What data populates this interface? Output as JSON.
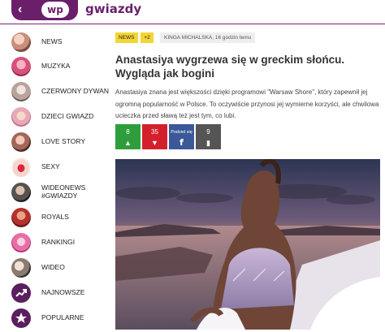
{
  "header": {
    "brand": "gwiazdy",
    "logo_text": "wp"
  },
  "sidebar": {
    "items": [
      {
        "label": "NEWS",
        "icon": "news-thumb-icon"
      },
      {
        "label": "MUZYKA",
        "icon": "music-thumb-icon"
      },
      {
        "label": "CZERWONY DYWAN",
        "icon": "red-carpet-thumb-icon"
      },
      {
        "label": "DZIECI GWIAZD",
        "icon": "star-kids-thumb-icon"
      },
      {
        "label": "LOVE STORY",
        "icon": "love-story-thumb-icon"
      },
      {
        "label": "SEXY",
        "icon": "sexy-thumb-icon"
      },
      {
        "label": "WIDEONEWS #GWIAZDY",
        "icon": "videonews-thumb-icon"
      },
      {
        "label": "ROYALS",
        "icon": "royals-thumb-icon"
      },
      {
        "label": "RANKINGI",
        "icon": "rankings-thumb-icon"
      },
      {
        "label": "WIDEO",
        "icon": "video-thumb-icon"
      },
      {
        "label": "NAJNOWSZE",
        "icon": "trending-arrow-icon"
      },
      {
        "label": "POPULARNE",
        "icon": "star-icon"
      }
    ]
  },
  "article": {
    "badge": "NEWS",
    "badge_count": "+2",
    "author": "KINGA MICHALSKA, 16 godzin temu",
    "title": "Anastasiya wygrzewa się w greckim słońcu. Wygląda jak bogini",
    "lead": "Anastasiya znana jest większości dzięki programowi \"Warsaw Shore\", który zapewnił jej ogromną popularność w Polsce. To oczywiście przynosi jej wymierne korzyści, ale chwilowa ucieczka przed sławą też jest tym, co lubi.",
    "social": {
      "likes": "8",
      "dislikes": "35",
      "share_label": "Podziel się",
      "comments": "9"
    }
  },
  "colors": {
    "brand": "#6b1f6b",
    "badge": "#f4d533",
    "like": "#2e9e3c",
    "dislike": "#d4202c",
    "facebook": "#3b5998"
  }
}
